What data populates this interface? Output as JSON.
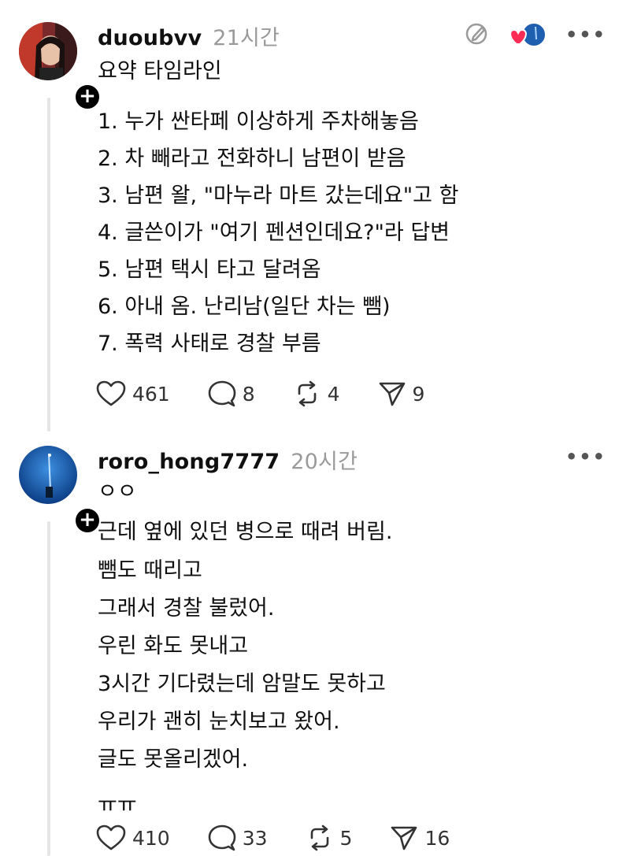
{
  "posts": [
    {
      "username": "duoubvv",
      "time": "21시간",
      "title": "요약 타임라인",
      "lines": [
        "1. 누가 싼타페 이상하게 주차해놓음",
        "2. 차 빼라고 전화하니 남편이 받음",
        "3. 남편 왈, \"마누라 마트 갔는데요\"고 함",
        "4. 글쓴이가 \"여기 펜션인데요?\"라 답변",
        "5. 남편 택시 타고 달려옴",
        "6. 아내 옴. 난리남(일단 차는 뺌)",
        "7. 폭력 사태로 경찰 부름"
      ],
      "likes": "461",
      "comments": "8",
      "reposts": "4",
      "shares": "9"
    },
    {
      "username": "roro_hong7777",
      "time": "20시간",
      "lines": [
        "ㅇㅇ",
        "근데 옆에 있던 병으로 때려 버림.",
        "뺌도 때리고",
        "그래서 경찰 불렀어.",
        "우린 화도 못내고",
        "3시간 기다렸는데 암말도 못하고",
        "우리가 괜히 눈치보고 왔어.",
        "글도 못올리겠어.",
        "ㅠㅠ"
      ],
      "likes": "410",
      "comments": "33",
      "reposts": "5",
      "shares": "16"
    }
  ],
  "more_label": "•••",
  "follow_label": "+",
  "icons": {
    "like": "heart-icon",
    "comment": "comment-icon",
    "repost": "repost-icon",
    "share": "share-icon",
    "quote_edit": "pencil-circle-icon",
    "liked_by": "heart-avatar-icon"
  },
  "colors": {
    "like_red": "#ff2d55",
    "muted": "#9a9a9a",
    "thread": "#e5e5e5"
  }
}
